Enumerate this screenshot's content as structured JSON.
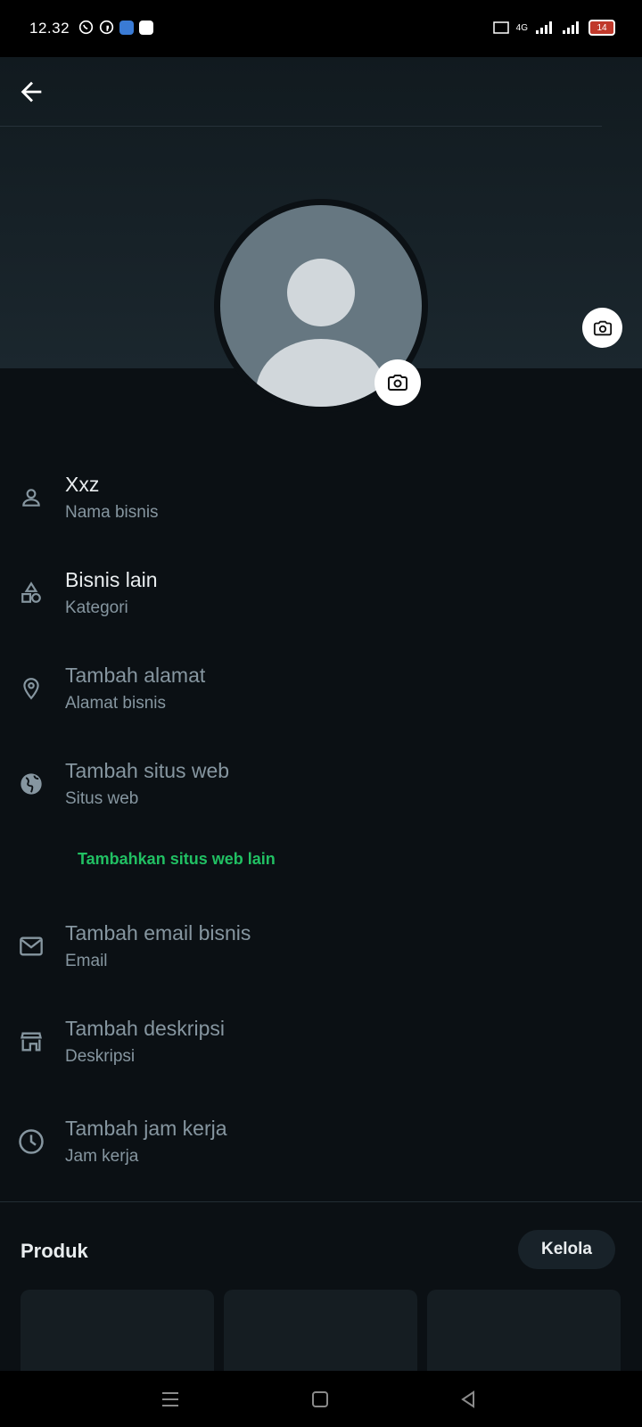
{
  "status_bar": {
    "time": "12.32",
    "notification_icons": [
      "whatsapp-icon",
      "facebook-icon",
      "app-blue-icon",
      "app-white-icon"
    ],
    "network_label": "4G",
    "battery": "14"
  },
  "header": {
    "back_icon": "arrow-back-icon"
  },
  "profile": {
    "cover_camera_icon": "camera-icon",
    "avatar_camera_icon": "camera-icon"
  },
  "fields": [
    {
      "icon": "person-icon",
      "primary": "Xxz",
      "secondary": "Nama bisnis",
      "filled": true
    },
    {
      "icon": "category-shapes-icon",
      "primary": "Bisnis lain",
      "secondary": "Kategori",
      "filled": true
    },
    {
      "icon": "location-pin-icon",
      "primary": "Tambah alamat",
      "secondary": "Alamat bisnis",
      "filled": false
    },
    {
      "icon": "globe-icon",
      "primary": "Tambah situs web",
      "secondary": "Situs web",
      "filled": false
    },
    {
      "icon": "mail-icon",
      "primary": "Tambah email bisnis",
      "secondary": "Email",
      "filled": false
    },
    {
      "icon": "store-icon",
      "primary": "Tambah deskripsi",
      "secondary": "Deskripsi",
      "filled": false
    },
    {
      "icon": "clock-icon",
      "primary": "Tambah jam kerja",
      "secondary": "Jam kerja",
      "filled": false
    }
  ],
  "add_website_link": "Tambahkan situs web lain",
  "products": {
    "title": "Produk",
    "manage_label": "Kelola"
  },
  "colors": {
    "accent": "#21c063",
    "background": "#0b1014",
    "avatar": "#667781"
  },
  "nav_bar": {
    "icons": [
      "menu-icon",
      "home-square-icon",
      "back-triangle-icon"
    ]
  }
}
